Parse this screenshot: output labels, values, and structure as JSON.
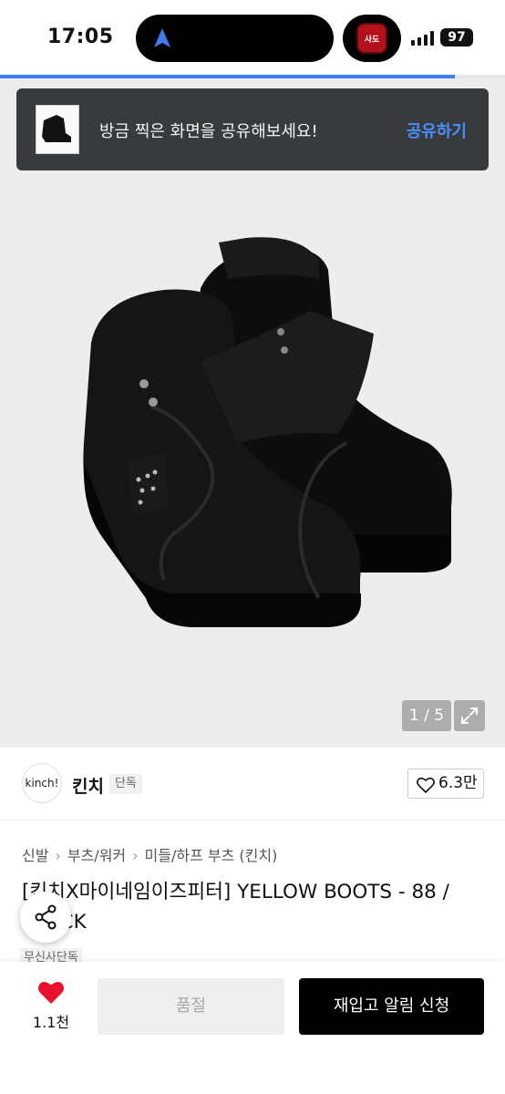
{
  "status_bar": {
    "time": "17:05",
    "battery": "97",
    "app_icon_label": "사도"
  },
  "toast": {
    "message": "방금 찍은 화면을 공유해보세요!",
    "action": "공유하기"
  },
  "image": {
    "counter": "1 / 5"
  },
  "brand": {
    "logo_text": "kinch!",
    "name": "킨치",
    "tag": "단독",
    "likes": "6.3만"
  },
  "breadcrumb": [
    "신발",
    "부츠/워커",
    "미들/하프 부츠 (킨치)"
  ],
  "product": {
    "title": "[킨치X마이네임이즈피터] YELLOW BOOTS - 88 / BLACK",
    "tag": "무신사단독"
  },
  "bottom_bar": {
    "wish_count": "1.1천",
    "soldout_label": "품절",
    "restock_label": "재입고 알림 신청"
  },
  "colors": {
    "accent_blue": "#3d7cf2",
    "heart_red": "#e8112d",
    "toast_bg": "#383b3e"
  }
}
